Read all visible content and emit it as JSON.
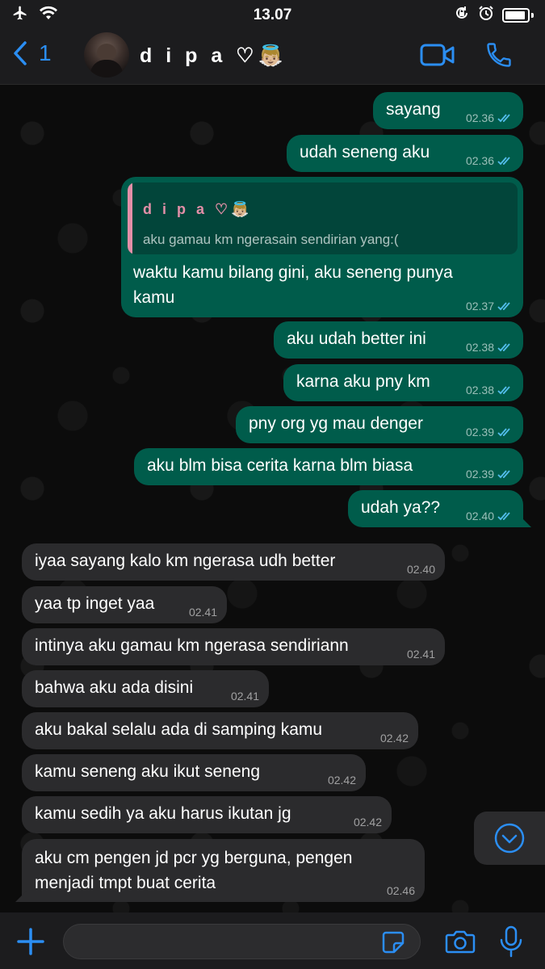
{
  "status_bar": {
    "time": "13.07"
  },
  "header": {
    "back_count": "1",
    "contact_name": "d i p a ♡👼🏼"
  },
  "colors": {
    "accent": "#2b8ef3",
    "outgoing_bubble": "#005c4b",
    "incoming_bubble": "#2b2b2d",
    "read_ticks": "#53bdeb",
    "quote_name": "#e38fa8"
  },
  "messages": [
    {
      "direction": "out",
      "text": "sayang",
      "time": "02.36",
      "read": true
    },
    {
      "direction": "out",
      "text": "udah seneng aku",
      "time": "02.36",
      "read": true
    },
    {
      "direction": "out",
      "reply_to": {
        "name": "d i p a ♡👼🏼",
        "text": "aku gamau km ngerasain sendirian yang:("
      },
      "text_lines": [
        "waktu kamu bilang gini, aku seneng punya",
        "kamu"
      ],
      "time": "02.37",
      "read": true
    },
    {
      "direction": "out",
      "text": "aku udah better ini",
      "time": "02.38",
      "read": true
    },
    {
      "direction": "out",
      "text": "karna aku pny km",
      "time": "02.38",
      "read": true
    },
    {
      "direction": "out",
      "text": "pny org yg mau denger",
      "time": "02.39",
      "read": true
    },
    {
      "direction": "out",
      "text": "aku blm bisa cerita karna blm biasa",
      "time": "02.39",
      "read": true
    },
    {
      "direction": "out",
      "text": "udah ya??",
      "time": "02.40",
      "read": true
    },
    {
      "direction": "in",
      "text": "iyaa sayang kalo km ngerasa udh better",
      "time": "02.40"
    },
    {
      "direction": "in",
      "text": "yaa tp inget yaa",
      "time": "02.41"
    },
    {
      "direction": "in",
      "text": "intinya aku gamau km ngerasa sendiriann",
      "time": "02.41"
    },
    {
      "direction": "in",
      "text": "bahwa aku ada disini",
      "time": "02.41"
    },
    {
      "direction": "in",
      "text": "aku bakal selalu ada di samping kamu",
      "time": "02.42"
    },
    {
      "direction": "in",
      "text": "kamu seneng aku ikut seneng",
      "time": "02.42"
    },
    {
      "direction": "in",
      "text": "kamu sedih ya aku harus ikutan jg",
      "time": "02.42"
    },
    {
      "direction": "in",
      "text_lines": [
        "aku cm pengen jd pcr yg berguna, pengen",
        "menjadi tmpt buat cerita"
      ],
      "time": "02.46"
    }
  ],
  "input": {
    "value": "",
    "placeholder": ""
  }
}
